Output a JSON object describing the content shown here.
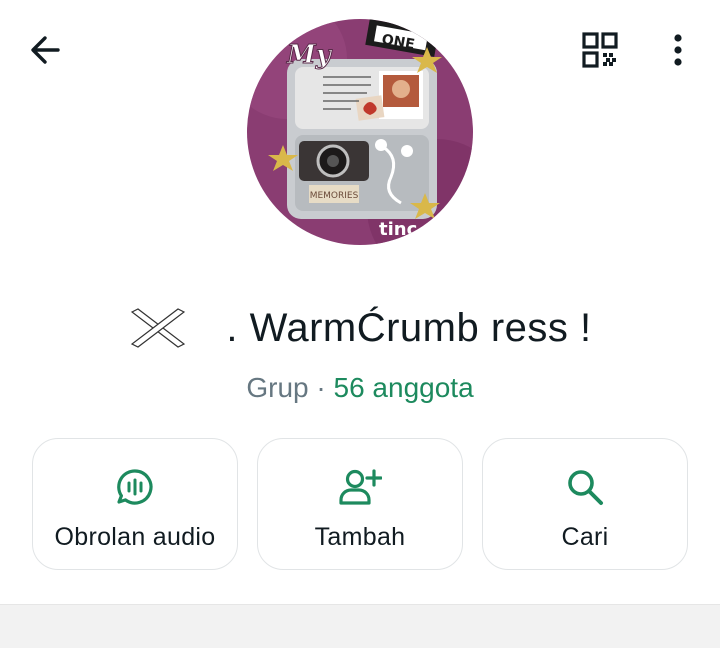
{
  "header": {
    "back_icon": "arrow-left-icon",
    "qr_icon": "qr-code-icon",
    "more_icon": "more-vertical-icon"
  },
  "avatar": {
    "text_my": "My",
    "sign_text": "ONE",
    "label_memories": "MEMORIES",
    "watermark": "tinc"
  },
  "group": {
    "emoji": "crossed-lines-icon",
    "name": ". WarmĆrumb ress !",
    "type": "Grup",
    "separator": "·",
    "members": "56 anggota"
  },
  "actions": [
    {
      "label": "Obrolan audio",
      "icon": "audio-chat-icon"
    },
    {
      "label": "Tambah",
      "icon": "add-person-icon"
    },
    {
      "label": "Cari",
      "icon": "search-icon"
    }
  ],
  "colors": {
    "accent": "#1d8a5e",
    "text": "#111b21",
    "muted": "#667781",
    "avatar_bg": "#8a3d72"
  }
}
